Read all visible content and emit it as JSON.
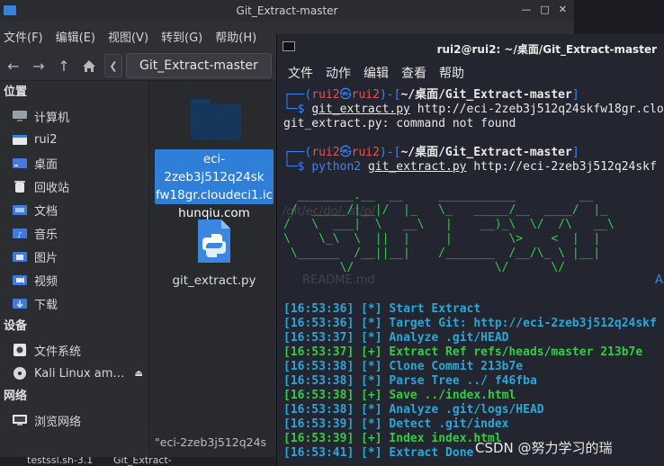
{
  "file_manager": {
    "window_title": "Git_Extract-master",
    "window_controls": [
      "—",
      "□",
      "✕"
    ],
    "menu": [
      "文件(F)",
      "编辑(E)",
      "视图(V)",
      "转到(G)",
      "帮助(H)"
    ],
    "breadcrumb": "Git_Extract-master",
    "sidebar": {
      "places_header": "位置",
      "places": [
        {
          "label": "计算机",
          "icon": "computer-icon"
        },
        {
          "label": "rui2",
          "icon": "home-folder-icon"
        },
        {
          "label": "桌面",
          "icon": "desktop-icon"
        },
        {
          "label": "回收站",
          "icon": "trash-icon"
        },
        {
          "label": "文档",
          "icon": "documents-icon"
        },
        {
          "label": "音乐",
          "icon": "music-icon"
        },
        {
          "label": "图片",
          "icon": "pictures-icon"
        },
        {
          "label": "视频",
          "icon": "videos-icon"
        },
        {
          "label": "下载",
          "icon": "downloads-icon"
        }
      ],
      "devices_header": "设备",
      "devices": [
        {
          "label": "文件系统",
          "icon": "drive-icon"
        },
        {
          "label": "Kali Linux am…",
          "icon": "optical-disc-icon"
        }
      ],
      "network_header": "网络",
      "network": [
        {
          "label": "浏览网络",
          "icon": "network-icon"
        }
      ]
    },
    "files": [
      {
        "name_lines": [
          "eci-2zeb3j512q24sk",
          "fw18gr.cloudeci1.ic",
          "hunqiu.com"
        ],
        "type": "folder"
      },
      {
        "name": "git_extract.py",
        "type": "python"
      }
    ],
    "status": "\"eci-2zeb3j512q24s",
    "colors": {
      "selection": "#2f7ed8",
      "folder": "#17365c"
    }
  },
  "taskbar": {
    "items": [
      "testssl.sh-3.1",
      "Git_Extract-"
    ]
  },
  "terminal": {
    "title": "rui2@rui2: ~/桌面/Git_Extract-master",
    "menu": [
      "文件",
      "动作",
      "编辑",
      "查看",
      "帮助"
    ],
    "prompt_user": "rui2",
    "prompt_host": "rui2",
    "prompt_path": "~/桌面/Git_Extract-master",
    "cmd1_program": "git_extract.py",
    "cmd1_args": " http://eci-2zeb3j512q24skfw18gr.clo",
    "error_line": "git_extract.py: command not found",
    "cmd2_program": "python2",
    "cmd2_script": "git_extract.py",
    "cmd2_args": " http://eci-2zeb3j512q24skf",
    "banner_lines": [
      "  ________.__  __     ___________         __",
      " /  _____/|__|/  |_   \\_   _____/__  ____/  |_",
      "/   \\  ___|  \\   __\\   |    __)_\\  \\/  /\\   __\\",
      "\\    \\_\\  \\  ||  |     |        \\>    <  |  |",
      " \\______  /__||__|    /_______  /__/\\_ \\ |__|",
      "        \\/                    \\/      \\/"
    ],
    "log": [
      {
        "time": "[16:53:36]",
        "tag": "[*]",
        "msg": "Start Extract"
      },
      {
        "time": "[16:53:36]",
        "tag": "[*]",
        "msg": "Target Git: http://eci-2zeb3j512q24skf"
      },
      {
        "time": "[16:53:37]",
        "tag": "[*]",
        "msg": "Analyze .git/HEAD"
      },
      {
        "time": "[16:53:37]",
        "tag": "[+]",
        "msg": "Extract Ref refs/heads/master 213b7e"
      },
      {
        "time": "[16:53:38]",
        "tag": "[*]",
        "msg": "Clone Commit 213b7e"
      },
      {
        "time": "[16:53:38]",
        "tag": "[*]",
        "msg": "Parse Tree ../ f46fba"
      },
      {
        "time": "[16:53:38]",
        "tag": "[+]",
        "msg": "Save ../index.html"
      },
      {
        "time": "[16:53:38]",
        "tag": "[*]",
        "msg": "Analyze .git/logs/HEAD"
      },
      {
        "time": "[16:53:39]",
        "tag": "[*]",
        "msg": "Detect .git/index"
      },
      {
        "time": "[16:53:39]",
        "tag": "[+]",
        "msg": "Index index.html"
      },
      {
        "time": "[16:53:41]",
        "tag": "[*]",
        "msg": "Extract Done"
      }
    ],
    "ghost_texts": [
      "/git/ec/do/..st/p/",
      "README.md",
      "A"
    ],
    "colors": {
      "prompt_blue": "#3c83f0",
      "prompt_user_red": "#e05555",
      "log_cyan": "#2aa7d6",
      "log_green": "#33cc44"
    }
  },
  "watermark": "CSDN @努力学习的瑞"
}
